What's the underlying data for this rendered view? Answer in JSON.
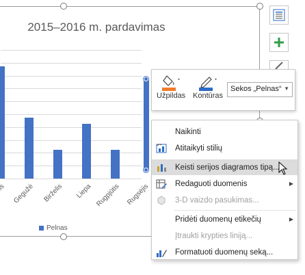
{
  "chart_data": {
    "type": "bar",
    "title": "2015–2016 m. pardavimas",
    "categories": [
      "dis",
      "Gegužė",
      "Birželis",
      "Liepa",
      "Rugpjūtis",
      "Rugsėjis"
    ],
    "series": [
      {
        "name": "Pelnas",
        "values": [
          17.5,
          9.5,
          4.5,
          8.5,
          4.5,
          13.5
        ]
      }
    ],
    "ylim": [
      0,
      20
    ],
    "grid": true,
    "legend_position": "bottom",
    "selected_series": "Pelnas",
    "color": "#4472c4"
  },
  "side_buttons": [
    "chart-styles-icon",
    "add-element-icon",
    "brush-icon"
  ],
  "mini_toolbar": {
    "fill_label": "Užpildas",
    "outline_label": "Kontūras",
    "series_select": "Sekos „Pelnas“",
    "fill_color": "#f07c2a",
    "outline_color": "#2e6bc6"
  },
  "context_menu": {
    "items": [
      {
        "label": "Naikinti",
        "icon": "",
        "disabled": false,
        "submenu": false
      },
      {
        "label": "Atitaikyti stilių",
        "icon": "reset-style-icon",
        "disabled": false,
        "submenu": false
      },
      {
        "label": "Keisti serijos diagramos tipą...",
        "icon": "chart-type-icon",
        "disabled": false,
        "submenu": false,
        "hover": true
      },
      {
        "label": "Redaguoti duomenis",
        "icon": "edit-data-icon",
        "disabled": false,
        "submenu": true
      },
      {
        "label": "3-D vaizdo pasukimas...",
        "icon": "rotate-3d-icon",
        "disabled": true,
        "submenu": false
      },
      {
        "label": "Pridėti duomenų etikečių",
        "icon": "",
        "disabled": false,
        "submenu": true
      },
      {
        "label": "Įtraukti krypties liniją...",
        "icon": "",
        "disabled": true,
        "submenu": false
      },
      {
        "label": "Formatuoti duomenų seką...",
        "icon": "format-series-icon",
        "disabled": false,
        "submenu": false
      }
    ]
  }
}
